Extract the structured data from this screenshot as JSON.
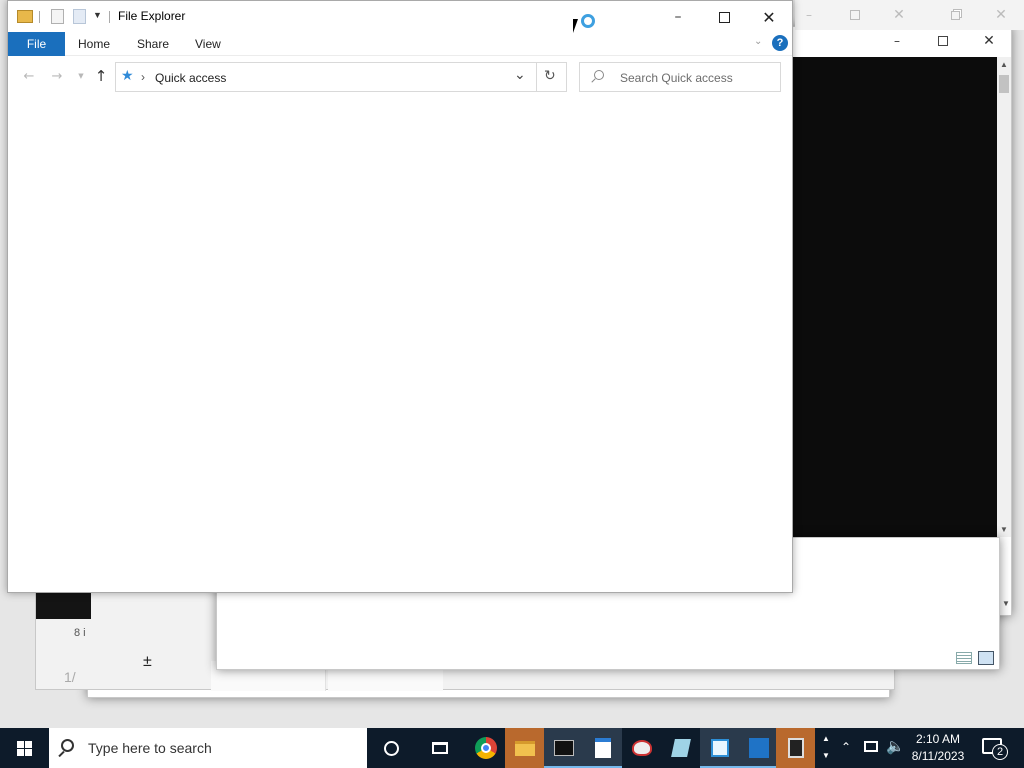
{
  "explorer": {
    "title": "File Explorer",
    "ribbon": {
      "file_tab": "File",
      "tabs": [
        "Home",
        "Share",
        "View"
      ]
    },
    "address": {
      "location": "Quick access"
    },
    "search": {
      "placeholder": "Search Quick access"
    }
  },
  "background_windows": {
    "status_fragment": "8 i",
    "calc_key": "±",
    "fraction_fragment": "1/"
  },
  "taskbar": {
    "search_placeholder": "Type here to search",
    "clock_time": "2:10 AM",
    "clock_date": "8/11/2023",
    "notification_count": "2",
    "pinned": [
      "cortana-icon",
      "task-view-icon",
      "chrome-icon",
      "file-explorer-icon",
      "command-prompt-icon",
      "wordpad-icon",
      "paint-icon",
      "app-icon",
      "notepad-icon",
      "blue-app-icon",
      "calculator-icon"
    ]
  },
  "colors": {
    "accent": "#1a6fbd",
    "taskbar": "#0d1b2a",
    "active_app": "#b9692d"
  }
}
